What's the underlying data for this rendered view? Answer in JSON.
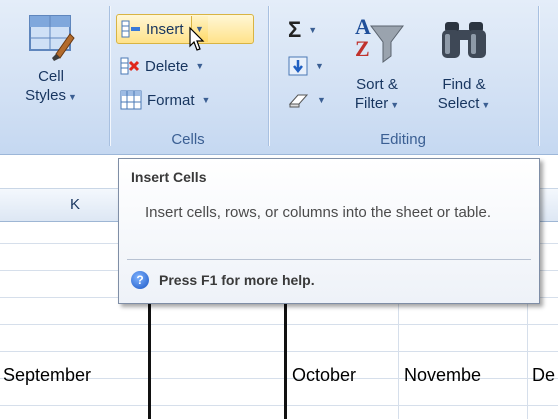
{
  "ribbon": {
    "styles_group": {
      "cell_styles_line1": "Cell",
      "cell_styles_line2": "Styles"
    },
    "cells_group": {
      "label": "Cells",
      "insert": "Insert",
      "delete": "Delete",
      "format": "Format"
    },
    "editing_group": {
      "label": "Editing",
      "sort_filter_line1": "Sort &",
      "sort_filter_line2": "Filter",
      "find_select_line1": "Find &",
      "find_select_line2": "Select",
      "sum_symbol": "Σ"
    }
  },
  "sheet": {
    "column_headers": [
      "K"
    ],
    "cells": [
      "September",
      "October",
      "Novembe",
      "De"
    ]
  },
  "tooltip": {
    "title": "Insert Cells",
    "body": "Insert cells, rows, or columns into the sheet or table.",
    "help": "Press F1 for more help."
  }
}
